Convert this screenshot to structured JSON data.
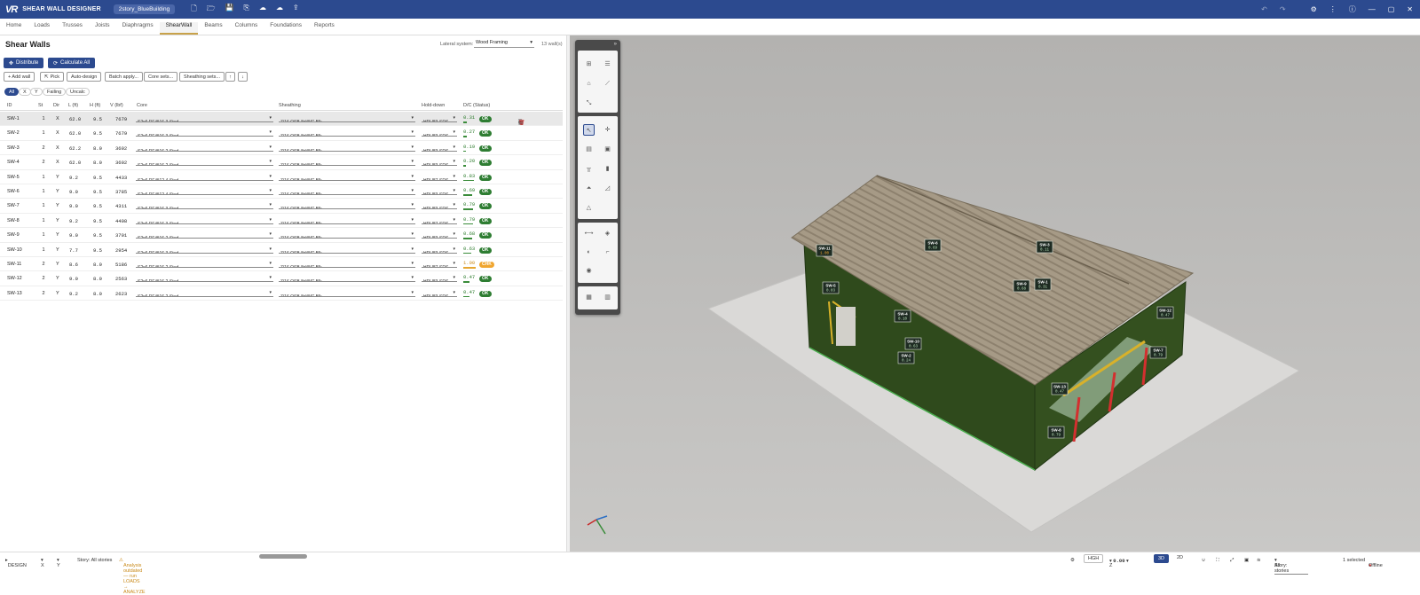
{
  "app": {
    "logo": "VR",
    "title": "SHEAR WALL DESIGNER",
    "project": "2story_BlueBuilding"
  },
  "toolbar_icons": [
    "new-file-icon",
    "open-folder-icon",
    "save-icon",
    "save-as-icon",
    "cloud-upload-icon",
    "cloud-download-icon",
    "export-icon"
  ],
  "window_icons": [
    "undo-icon",
    "redo-icon",
    "settings-icon",
    "more-icon",
    "info-icon",
    "minimize-icon",
    "maximize-icon",
    "close-icon"
  ],
  "menu": {
    "tabs": [
      "Home",
      "Loads",
      "Trusses",
      "Joists",
      "Diaphragms",
      "ShearWall",
      "Beams",
      "Columns",
      "Foundations",
      "Reports"
    ],
    "active": "ShearWall"
  },
  "panel": {
    "title": "Shear Walls",
    "lateral_label": "Lateral system:",
    "lateral_value": "Wood Framing",
    "wall_count": "13 wall(s)",
    "distribute_label": "Distribute",
    "calculate_label": "Calculate All",
    "actions": {
      "add_wall": "+ Add wall",
      "pick": "Pick",
      "auto_design": "Auto-design",
      "batch_apply": "Batch apply...",
      "core_sets": "Core sets...",
      "sheathing_sets": "Sheathing sets..."
    },
    "filters": [
      "All",
      "X",
      "Y",
      "Failing",
      "Uncalc"
    ],
    "columns": {
      "id": "ID",
      "st": "St",
      "dir": "Dir",
      "l": "L (ft)",
      "h": "H (ft)",
      "v": "V (lbf)",
      "core": "Core",
      "sheathing": "Sheathing",
      "holddown": "Hold-down",
      "dc": "D/C (Status)"
    },
    "rows": [
      {
        "id": "SW-1",
        "st": "1",
        "dir": "X",
        "l": "62.0",
        "h": "9.5",
        "v": "7679",
        "core": "S2x6 DF@16 3-Stud",
        "sheathing": "7/16 OSB 8d@6\" Blk",
        "hd": "HDU83-SDS",
        "dc": "0.31",
        "status": "OK"
      },
      {
        "id": "SW-2",
        "st": "1",
        "dir": "X",
        "l": "62.0",
        "h": "9.5",
        "v": "7679",
        "core": "S2x6 DF@16 3-Stud",
        "sheathing": "7/16 OSB 8d@6\" Blk",
        "hd": "HDU83-SDS",
        "dc": "0.27",
        "status": "OK"
      },
      {
        "id": "SW-3",
        "st": "2",
        "dir": "X",
        "l": "62.2",
        "h": "8.0",
        "v": "3602",
        "core": "S2x6 DF@16 2-Stud",
        "sheathing": "7/16 OSB 8d@6\" Blk",
        "hd": "HDU83-SDS",
        "dc": "0.19",
        "status": "OK"
      },
      {
        "id": "SW-4",
        "st": "2",
        "dir": "X",
        "l": "62.0",
        "h": "8.0",
        "v": "3602",
        "core": "S2x6 DF@16 2-Stud",
        "sheathing": "7/16 OSB 8d@6\" Blk",
        "hd": "HDU83-SDS",
        "dc": "0.20",
        "status": "OK"
      },
      {
        "id": "SW-5",
        "st": "1",
        "dir": "Y",
        "l": "9.2",
        "h": "9.5",
        "v": "4433",
        "core": "S2x6 DF@12 4-Stud",
        "sheathing": "7/16 OSB 8d@6\" Blk",
        "hd": "HDU87-SDS",
        "dc": "0.83",
        "status": "OK"
      },
      {
        "id": "SW-6",
        "st": "1",
        "dir": "Y",
        "l": "9.0",
        "h": "9.5",
        "v": "3785",
        "core": "S2x6 DF@12 4-Stud",
        "sheathing": "7/16 OSB 8d@6\" Blk",
        "hd": "HDU83-SDS",
        "dc": "0.69",
        "status": "OK"
      },
      {
        "id": "SW-7",
        "st": "1",
        "dir": "Y",
        "l": "9.0",
        "h": "9.5",
        "v": "4311",
        "core": "S2x6 DF@16 3-Stud",
        "sheathing": "7/16 OSB 8d@6\" Blk",
        "hd": "HDU83-SDS",
        "dc": "0.79",
        "status": "OK"
      },
      {
        "id": "SW-8",
        "st": "1",
        "dir": "Y",
        "l": "9.2",
        "h": "9.5",
        "v": "4408",
        "core": "S2x6 DF@16 3-Stud",
        "sheathing": "7/16 OSB 8d@6\" Blk",
        "hd": "HDU87-SDS",
        "dc": "0.79",
        "status": "OK"
      },
      {
        "id": "SW-9",
        "st": "1",
        "dir": "Y",
        "l": "9.0",
        "h": "9.5",
        "v": "3701",
        "core": "S2x6 DF@16 2-Stud",
        "sheathing": "7/16 OSB 8d@6\" Blk",
        "hd": "HDU83-SDS",
        "dc": "0.68",
        "status": "OK"
      },
      {
        "id": "SW-10",
        "st": "1",
        "dir": "Y",
        "l": "7.7",
        "h": "9.5",
        "v": "2954",
        "core": "S2x6 DF@16 3-Stud",
        "sheathing": "7/16 OSB 8d@6\" Blk",
        "hd": "HDU83-SDS",
        "dc": "0.63",
        "status": "OK"
      },
      {
        "id": "SW-11",
        "st": "2",
        "dir": "Y",
        "l": "8.6",
        "h": "8.0",
        "v": "5186",
        "core": "S2x6 DF@16 2-Stud",
        "sheathing": "7/16 OSB 8d@6\" Blk",
        "hd": "HDU87-SDS",
        "dc": "1.00",
        "status": "CHK"
      },
      {
        "id": "SW-12",
        "st": "2",
        "dir": "Y",
        "l": "9.0",
        "h": "8.0",
        "v": "2563",
        "core": "S2x6 DF@16 2-Stud",
        "sheathing": "7/16 OSB 8d@6\" Blk",
        "hd": "HDU83-SDS",
        "dc": "0.47",
        "status": "OK"
      },
      {
        "id": "SW-13",
        "st": "2",
        "dir": "Y",
        "l": "9.2",
        "h": "8.0",
        "v": "2623",
        "core": "S2x6 DF@16 2-Stud",
        "sheathing": "7/16 OSB 8d@6\" Blk",
        "hd": "HDU83-SDS",
        "dc": "0.47",
        "status": "OK"
      }
    ]
  },
  "viewport_labels": [
    {
      "id": "SW-11",
      "dc": "1.00",
      "warn": true
    },
    {
      "id": "SW-6",
      "dc": "0.69"
    },
    {
      "id": "SW-3",
      "dc": "0.11"
    },
    {
      "id": "SW-5",
      "dc": "0.83"
    },
    {
      "id": "SW-9",
      "dc": "0.68"
    },
    {
      "id": "SW-1",
      "dc": "0.31"
    },
    {
      "id": "SW-4",
      "dc": "0.10"
    },
    {
      "id": "SW-12",
      "dc": "0.47"
    },
    {
      "id": "SW-10",
      "dc": "0.63"
    },
    {
      "id": "SW-2",
      "dc": "0.24"
    },
    {
      "id": "SW-7",
      "dc": "0.79"
    },
    {
      "id": "SW-13",
      "dc": "0.47"
    },
    {
      "id": "SW-8",
      "dc": "0.79"
    }
  ],
  "colors": {
    "brand": "#2c4a8f",
    "ok": "#2e7d32",
    "warn": "#f0a630",
    "wall": "#2f4a1c",
    "ground": "#d6d5d3",
    "roof": "#9c8f7c"
  },
  "statusbar": {
    "mode": "DESIGN",
    "x": "X",
    "y": "Y",
    "story": "Story: All stories",
    "analysis_msg": "Analysis outdated — run LOADS → ANALYZE",
    "hgh": "HGH",
    "z_label": "Z",
    "z_value": "0.00",
    "view3d": "3D",
    "view2d": "2D",
    "story_label": "Story:",
    "story_value": "All stories",
    "selected": "1 selected",
    "online": "Offline"
  }
}
